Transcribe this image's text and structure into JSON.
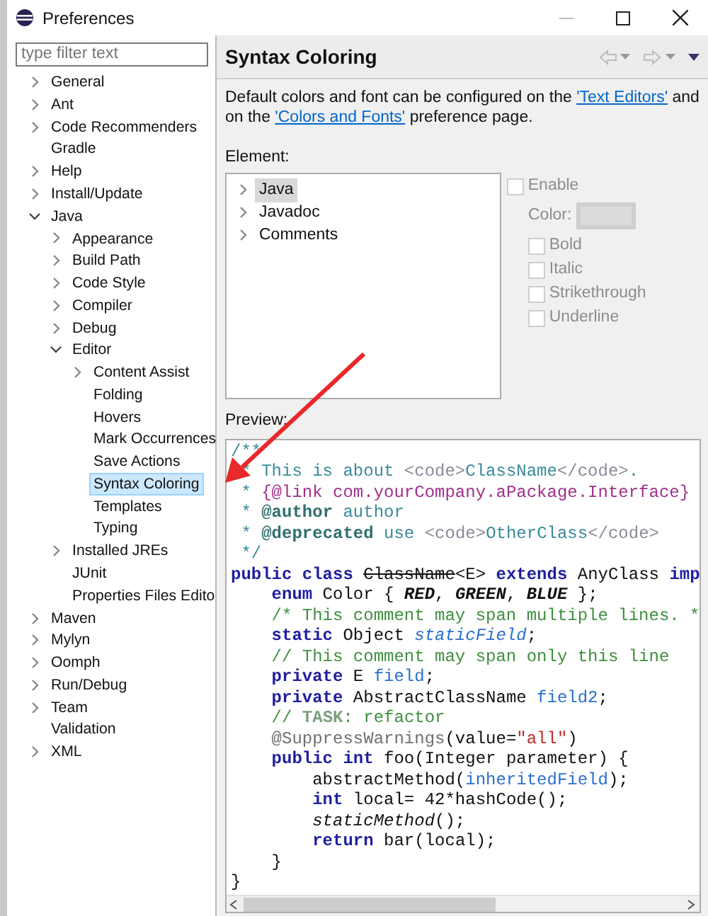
{
  "window": {
    "title": "Preferences"
  },
  "filter": {
    "placeholder": "type filter text"
  },
  "tree": [
    {
      "label": "General",
      "expanded": false,
      "selected": false
    },
    {
      "label": "Ant",
      "expanded": false,
      "selected": false
    },
    {
      "label": "Code Recommenders",
      "expanded": false,
      "selected": false
    },
    {
      "label": "Gradle",
      "selected": false
    },
    {
      "label": "Help",
      "expanded": false,
      "selected": false
    },
    {
      "label": "Install/Update",
      "expanded": false,
      "selected": false
    },
    {
      "label": "Java",
      "expanded": true,
      "selected": false,
      "children": [
        {
          "label": "Appearance",
          "expanded": false,
          "selected": false
        },
        {
          "label": "Build Path",
          "expanded": false,
          "selected": false
        },
        {
          "label": "Code Style",
          "expanded": false,
          "selected": false
        },
        {
          "label": "Compiler",
          "expanded": false,
          "selected": false
        },
        {
          "label": "Debug",
          "expanded": false,
          "selected": false
        },
        {
          "label": "Editor",
          "expanded": true,
          "selected": false,
          "children": [
            {
              "label": "Content Assist",
              "expanded": false,
              "selected": false
            },
            {
              "label": "Folding",
              "selected": false
            },
            {
              "label": "Hovers",
              "selected": false
            },
            {
              "label": "Mark Occurrences",
              "selected": false
            },
            {
              "label": "Save Actions",
              "selected": false
            },
            {
              "label": "Syntax Coloring",
              "selected": true
            },
            {
              "label": "Templates",
              "selected": false
            },
            {
              "label": "Typing",
              "selected": false
            }
          ]
        },
        {
          "label": "Installed JREs",
          "expanded": false,
          "selected": false
        },
        {
          "label": "JUnit",
          "selected": false
        },
        {
          "label": "Properties Files Edito",
          "selected": false
        }
      ]
    },
    {
      "label": "Maven",
      "expanded": false,
      "selected": false
    },
    {
      "label": "Mylyn",
      "expanded": false,
      "selected": false
    },
    {
      "label": "Oomph",
      "expanded": false,
      "selected": false
    },
    {
      "label": "Run/Debug",
      "expanded": false,
      "selected": false
    },
    {
      "label": "Team",
      "expanded": false,
      "selected": false
    },
    {
      "label": "Validation",
      "selected": false
    },
    {
      "label": "XML",
      "expanded": false,
      "selected": false
    }
  ],
  "page": {
    "title": "Syntax Coloring",
    "description": [
      {
        "text": "Default colors and font can be configured on the ",
        "kind": "text"
      },
      {
        "text": "'Text Editors'",
        "kind": "link"
      },
      {
        "text": " and on the ",
        "kind": "text"
      },
      {
        "text": "'Colors and Fonts'",
        "kind": "link"
      },
      {
        "text": " preference page.",
        "kind": "text"
      }
    ],
    "element_label": "Element:",
    "elements": [
      {
        "label": "Java",
        "expanded": false,
        "selected": true
      },
      {
        "label": "Javadoc",
        "expanded": false,
        "selected": false
      },
      {
        "label": "Comments",
        "expanded": false,
        "selected": false
      }
    ],
    "enable": {
      "label": "Enable",
      "checked": false,
      "disabled": true
    },
    "color_label": "Color:",
    "options": [
      {
        "label": "Bold",
        "checked": false,
        "disabled": true
      },
      {
        "label": "Italic",
        "checked": false,
        "disabled": true
      },
      {
        "label": "Strikethrough",
        "checked": false,
        "disabled": true
      },
      {
        "label": "Underline",
        "checked": false,
        "disabled": true
      }
    ],
    "preview_label": "Preview:",
    "preview": [
      [
        {
          "text": "/**",
          "kind": "javadoc"
        }
      ],
      [
        {
          "text": " * This is about ",
          "kind": "javadoc"
        },
        {
          "text": "<code>",
          "kind": "html"
        },
        {
          "text": "ClassName",
          "kind": "javadoc"
        },
        {
          "text": "</code>",
          "kind": "html"
        },
        {
          "text": ".",
          "kind": "javadoc"
        }
      ],
      [
        {
          "text": " * ",
          "kind": "javadoc"
        },
        {
          "text": "{@link com.yourCompany.aPackage.Interface}",
          "kind": "link"
        }
      ],
      [
        {
          "text": " * ",
          "kind": "javadoc"
        },
        {
          "text": "@author",
          "kind": "tag"
        },
        {
          "text": " author",
          "kind": "javadoc"
        }
      ],
      [
        {
          "text": " * ",
          "kind": "javadoc"
        },
        {
          "text": "@deprecated",
          "kind": "tag"
        },
        {
          "text": " use ",
          "kind": "javadoc"
        },
        {
          "text": "<code>",
          "kind": "html"
        },
        {
          "text": "OtherClass",
          "kind": "javadoc"
        },
        {
          "text": "</code>",
          "kind": "html"
        }
      ],
      [
        {
          "text": " */",
          "kind": "javadoc"
        }
      ],
      [
        {
          "text": "public class ",
          "kind": "keyword"
        },
        {
          "text": "ClassName",
          "kind": "deprecated"
        },
        {
          "text": "<E> ",
          "kind": "plain"
        },
        {
          "text": "extends",
          "kind": "keyword"
        },
        {
          "text": " AnyClass ",
          "kind": "plain"
        },
        {
          "text": "imp",
          "kind": "keyword"
        }
      ],
      [
        {
          "text": "    enum",
          "kind": "keyword"
        },
        {
          "text": " Color { ",
          "kind": "plain"
        },
        {
          "text": "RED",
          "kind": "constant"
        },
        {
          "text": ", ",
          "kind": "plain"
        },
        {
          "text": "GREEN",
          "kind": "constant"
        },
        {
          "text": ", ",
          "kind": "plain"
        },
        {
          "text": "BLUE",
          "kind": "constant"
        },
        {
          "text": " };",
          "kind": "plain"
        }
      ],
      [
        {
          "text": "    /* This comment may span multiple lines. *",
          "kind": "comment"
        }
      ],
      [
        {
          "text": "    static",
          "kind": "keyword"
        },
        {
          "text": " Object ",
          "kind": "plain"
        },
        {
          "text": "staticField",
          "kind": "static_field"
        },
        {
          "text": ";",
          "kind": "plain"
        }
      ],
      [
        {
          "text": "    // This comment may span only this line",
          "kind": "comment"
        }
      ],
      [
        {
          "text": "    private",
          "kind": "keyword"
        },
        {
          "text": " E ",
          "kind": "plain"
        },
        {
          "text": "field",
          "kind": "field"
        },
        {
          "text": ";",
          "kind": "plain"
        }
      ],
      [
        {
          "text": "    private",
          "kind": "keyword"
        },
        {
          "text": " AbstractClassName ",
          "kind": "plain"
        },
        {
          "text": "field2",
          "kind": "field"
        },
        {
          "text": ";",
          "kind": "plain"
        }
      ],
      [
        {
          "text": "    // ",
          "kind": "comment"
        },
        {
          "text": "TASK",
          "kind": "task"
        },
        {
          "text": ": refactor",
          "kind": "comment"
        }
      ],
      [
        {
          "text": "    @SuppressWarnings",
          "kind": "annotation"
        },
        {
          "text": "(value=",
          "kind": "plain"
        },
        {
          "text": "\"all\"",
          "kind": "string"
        },
        {
          "text": ")",
          "kind": "plain"
        }
      ],
      [
        {
          "text": "    public int",
          "kind": "keyword"
        },
        {
          "text": " foo(Integer parameter) {",
          "kind": "plain"
        }
      ],
      [
        {
          "text": "        abstractMethod(",
          "kind": "plain"
        },
        {
          "text": "inheritedField",
          "kind": "field"
        },
        {
          "text": ");",
          "kind": "plain"
        }
      ],
      [
        {
          "text": "        int",
          "kind": "keyword"
        },
        {
          "text": " local= 42*hashCode();",
          "kind": "plain"
        }
      ],
      [
        {
          "text": "        staticMethod",
          "kind": "static_method"
        },
        {
          "text": "();",
          "kind": "plain"
        }
      ],
      [
        {
          "text": "        return",
          "kind": "keyword"
        },
        {
          "text": " bar(local);",
          "kind": "plain"
        }
      ],
      [
        {
          "text": "    }",
          "kind": "plain"
        }
      ],
      [
        {
          "text": "}",
          "kind": "plain"
        }
      ]
    ]
  }
}
